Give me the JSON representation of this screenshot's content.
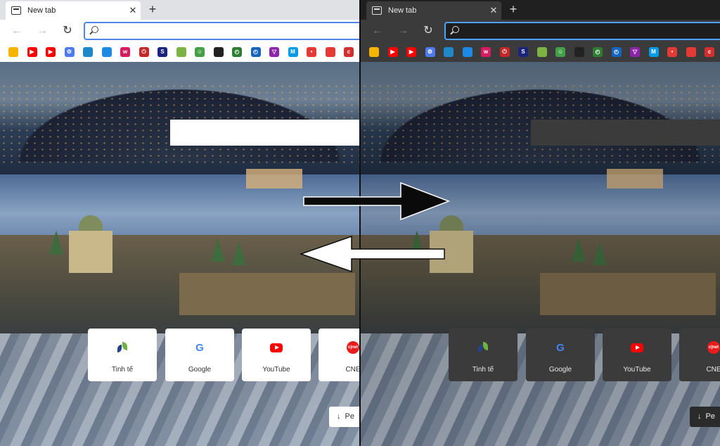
{
  "browser": {
    "tab_title": "New tab",
    "tab_close": "✕",
    "new_tab_button": "+",
    "back": "←",
    "forward": "→",
    "reload": "↻"
  },
  "favorites": [
    {
      "icon": "pinwheel-icon",
      "color": "#f4b400",
      "glyph": ""
    },
    {
      "icon": "youtube-icon",
      "color": "#ff0000",
      "glyph": "▶"
    },
    {
      "icon": "youtube-icon",
      "color": "#ff0000",
      "glyph": "▶"
    },
    {
      "icon": "gear-icon",
      "color": "#4e7cf0",
      "glyph": "⚙"
    },
    {
      "icon": "bridge-icon",
      "color": "#1e88c8",
      "glyph": ""
    },
    {
      "icon": "windows-icon",
      "color": "#1e88e5",
      "glyph": ""
    },
    {
      "icon": "w-icon",
      "color": "#d81b60",
      "glyph": "w"
    },
    {
      "icon": "power-icon",
      "color": "#c62828",
      "glyph": "⏻"
    },
    {
      "icon": "s-icon",
      "color": "#1a237e",
      "glyph": "S"
    },
    {
      "icon": "android-icon",
      "color": "#7cb342",
      "glyph": ""
    },
    {
      "icon": "smiley-icon",
      "color": "#43a047",
      "glyph": "☺"
    },
    {
      "icon": "bird-icon",
      "color": "#222222",
      "glyph": ""
    },
    {
      "icon": "clock-icon",
      "color": "#2e7d32",
      "glyph": "◴"
    },
    {
      "icon": "clock-icon",
      "color": "#1565c0",
      "glyph": "◴"
    },
    {
      "icon": "v-icon",
      "color": "#8e24aa",
      "glyph": "▽"
    },
    {
      "icon": "m-icon",
      "color": "#039be5",
      "glyph": "M"
    },
    {
      "icon": "news-icon",
      "color": "#e53935",
      "glyph": "•"
    },
    {
      "icon": "apple-icon",
      "color": "#e53935",
      "glyph": ""
    },
    {
      "icon": "cnet-icon",
      "color": "#d32f2f",
      "glyph": "c"
    }
  ],
  "tiles": [
    {
      "label": "Tinh tế",
      "icon": "tinhte-icon"
    },
    {
      "label": "Google",
      "icon": "google-icon"
    },
    {
      "label": "YouTube",
      "icon": "youtube-icon"
    },
    {
      "label": "CNE",
      "icon": "cnet-icon"
    }
  ],
  "tile_icon_text": {
    "google": "G",
    "cnet": "c|net"
  },
  "feed_button": {
    "arrow": "↓",
    "label": "Pe"
  },
  "themes": {
    "light": "#ffffff",
    "dark": "#3b3b3b",
    "arrow": "#0a0a0a",
    "arrow_outline": "#ffffff"
  }
}
